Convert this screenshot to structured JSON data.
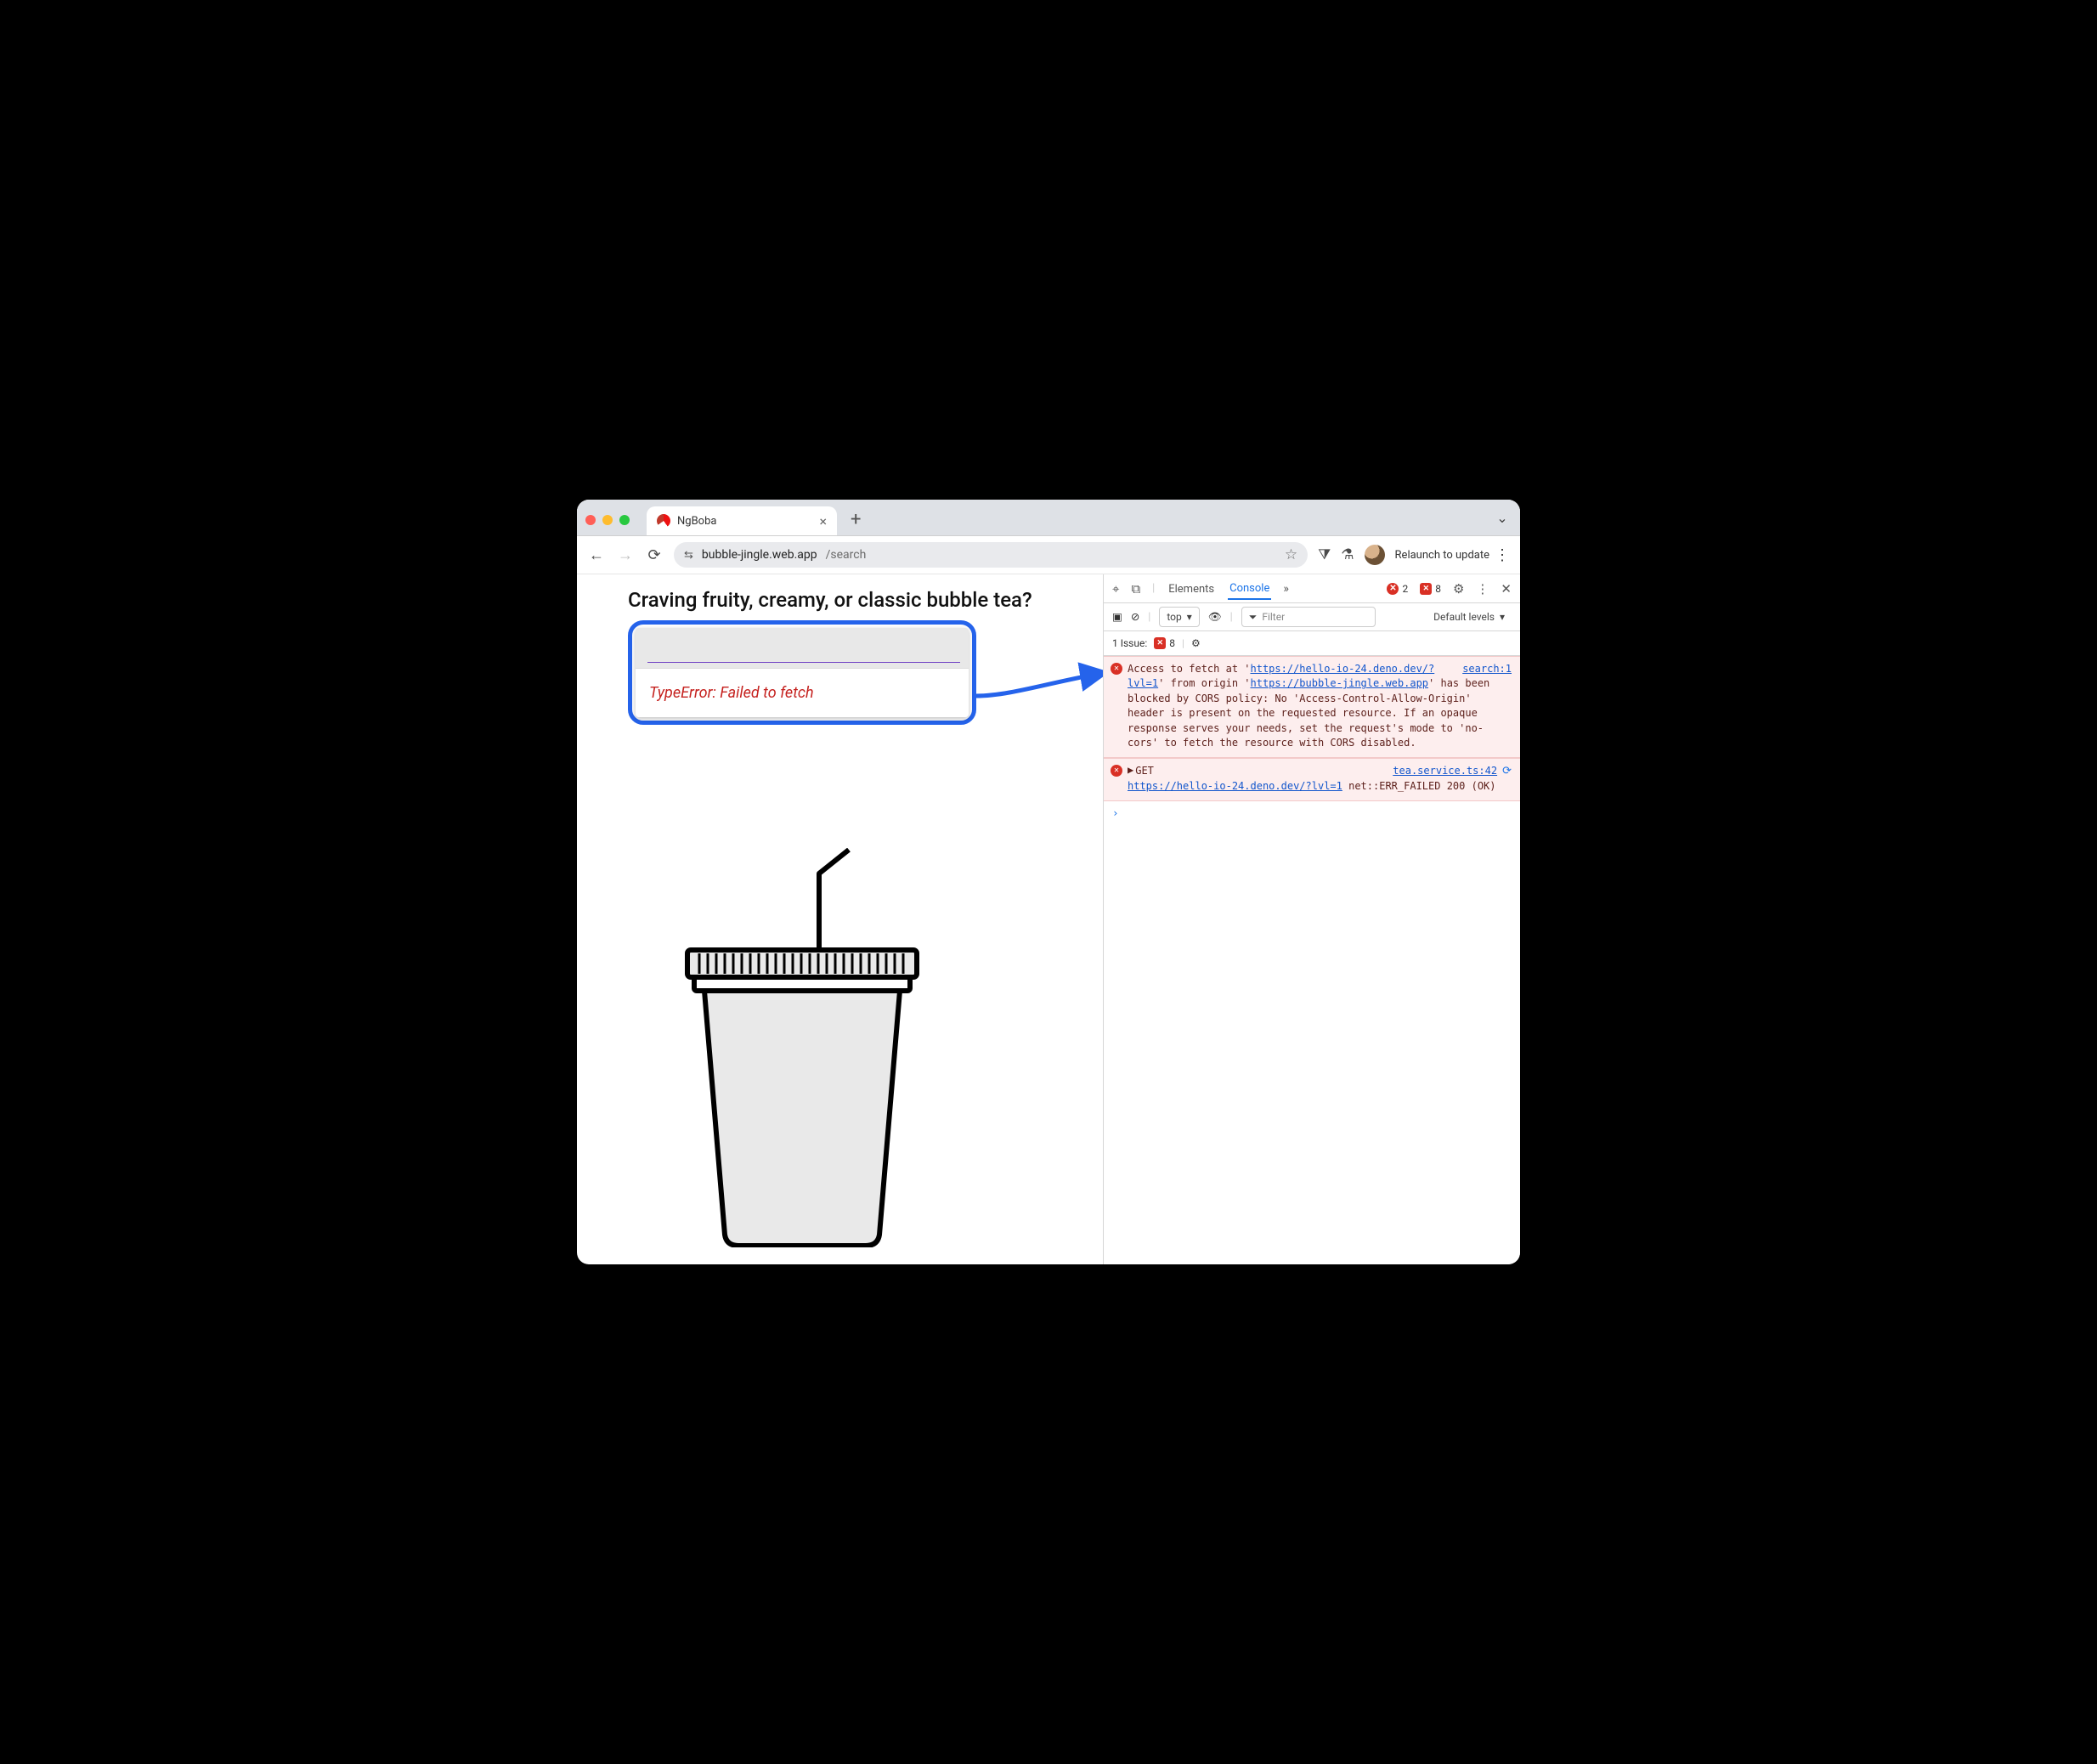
{
  "browser": {
    "tab_title": "NgBoba",
    "new_tab_glyph": "+",
    "close_glyph": "×",
    "expand_glyph": "⌄",
    "nav": {
      "back": "←",
      "forward": "→",
      "reload": "⟳"
    },
    "url": {
      "site_icon": "⇆",
      "host": "bubble-jingle.web.app",
      "path": "/search",
      "star": "☆"
    },
    "extensions_icon": "⧩",
    "experiments_icon": "⚗",
    "relaunch_label": "Relaunch to update",
    "kebab": "⋮"
  },
  "page": {
    "heading": "Craving fruity, creamy, or classic bubble tea?",
    "search_value": "",
    "search_placeholder": "",
    "error_text": "TypeError: Failed to fetch"
  },
  "devtools": {
    "inspect_icon": "⌖",
    "device_icon": "⧉",
    "tabs": {
      "elements": "Elements",
      "console": "Console"
    },
    "overflow": "»",
    "error_count": "2",
    "warn_count": "8",
    "gear": "⚙",
    "kebab": "⋮",
    "close": "✕",
    "sub": {
      "sidebar_icon": "▣",
      "clear_icon": "⊘",
      "context": "top",
      "context_caret": "▾",
      "eye_icon": "👁",
      "filter_icon": "⏷",
      "filter_placeholder": "Filter",
      "levels": "Default levels",
      "levels_caret": "▾"
    },
    "issue_row": {
      "label": "1 Issue:",
      "count": "8",
      "gear": "⚙"
    },
    "messages": [
      {
        "source": "search:1",
        "pre": "Access to fetch at '",
        "url1": "https://hello-io-24.deno.dev/?lvl=1",
        "mid1": "' from origin '",
        "url2": "https://bubble-jingle.web.app",
        "post": "' has been blocked by CORS policy: No 'Access-Control-Allow-Origin' header is present on the requested resource. If an opaque response serves your needs, set the request's mode to 'no-cors' to fetch the resource with CORS disabled."
      },
      {
        "source": "tea.service.ts:42",
        "tri": "▶",
        "head": "GET",
        "url": "https://hello-io-24.deno.dev/?lvl=1",
        "tail": " net::ERR_FAILED 200 (OK)"
      }
    ],
    "prompt": "›"
  }
}
